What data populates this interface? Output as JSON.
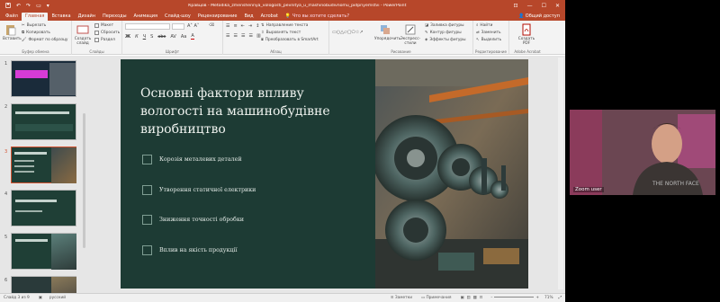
{
  "titlebar": {
    "doc_title": "Кравцов - Metodika_zmenshennya_vologosti_pevnitya_u_mashinobudivnomu_pidpriyemstvi - PowerPoint",
    "undo_icon": "undo-icon",
    "redo_icon": "redo-icon"
  },
  "tabs": [
    {
      "label": "Файл"
    },
    {
      "label": "Главная"
    },
    {
      "label": "Вставка"
    },
    {
      "label": "Дизайн"
    },
    {
      "label": "Переходы"
    },
    {
      "label": "Анимация"
    },
    {
      "label": "Слайд-шоу"
    },
    {
      "label": "Рецензирование"
    },
    {
      "label": "Вид"
    },
    {
      "label": "Acrobat"
    }
  ],
  "tell_me": "Что вы хотите сделать?",
  "share": "Общий доступ",
  "ribbon": {
    "paste": "Вставить",
    "cut": "Вырезать",
    "copy": "Копировать",
    "format_painter": "Формат по образцу",
    "clipboard_group": "Буфер обмена",
    "new_slide": "Создать слайд",
    "layout": "Макет",
    "reset": "Сбросить",
    "section": "Раздел",
    "slides_group": "Слайды",
    "font_group": "Шрифт",
    "text_direction": "Направление текста",
    "align_text": "Выровнять текст",
    "smartart": "Преобразовать в SmartArt",
    "paragraph_group": "Абзац",
    "arrange": "Упорядочить",
    "quick_styles": "Экспресс-стили",
    "shape_fill": "Заливка фигуры",
    "shape_outline": "Контур фигуры",
    "shape_effects": "Эффекты фигуры",
    "drawing_group": "Рисование",
    "find": "Найти",
    "replace": "Заменить",
    "select": "Выделить",
    "editing_group": "Редактирование",
    "create_pdf": "Создать PDF",
    "acrobat_group": "Adobe Acrobat"
  },
  "thumbnails": [
    {
      "num": "1"
    },
    {
      "num": "2"
    },
    {
      "num": "3"
    },
    {
      "num": "4"
    },
    {
      "num": "5"
    },
    {
      "num": "6"
    }
  ],
  "slide": {
    "title": "Основні фактори впливу вологості на машинобудівне виробництво",
    "bullets": [
      "Корозія металевих деталей",
      "Утворення статичної електрики",
      "Зниження точності обробки",
      "Вплив на якість продукції"
    ],
    "image_alt": "industrial-machinery-image"
  },
  "status": {
    "slide_counter": "Слайд 3 из 9",
    "language": "русский",
    "notes": "Заметки",
    "comments": "Примечания",
    "zoom": "71%"
  },
  "zoom_call": {
    "participant": "Zoom user"
  },
  "colors": {
    "accent": "#b7472a",
    "slide_bg": "#1d3b34"
  }
}
